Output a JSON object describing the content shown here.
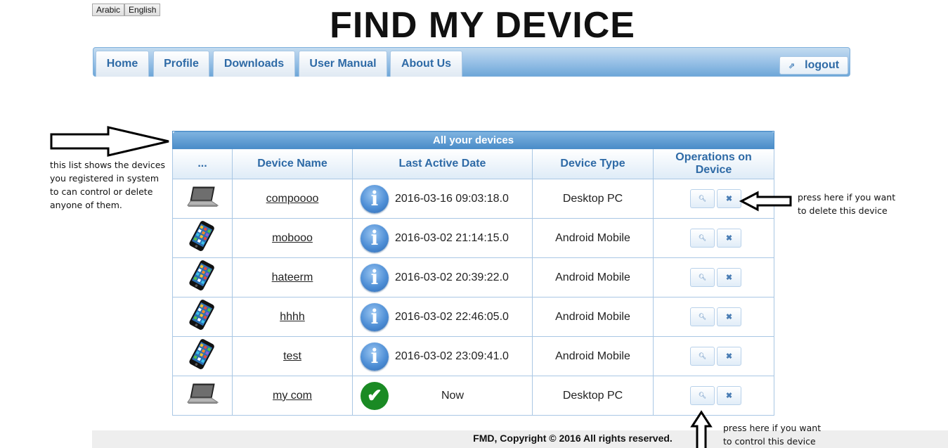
{
  "languages": [
    "Arabic",
    "English"
  ],
  "page_title": "FIND MY DEVICE",
  "nav": {
    "tabs": [
      "Home",
      "Profile",
      "Downloads",
      "User Manual",
      "About Us"
    ],
    "logout_label": "logout"
  },
  "annotations": {
    "list_note": [
      "this list shows the devices",
      "you registered in system",
      "to can control or delete",
      "anyone of them."
    ],
    "delete_note": [
      "press here if you want",
      "to delete this device"
    ],
    "control_note": [
      "press here if you want",
      "to control this device"
    ]
  },
  "table": {
    "caption": "All your devices",
    "headers": [
      "...",
      "Device Name",
      "Last Active Date",
      "Device Type",
      "Operations on Device"
    ],
    "rows": [
      {
        "icon": "laptop-icon",
        "name": "compoooo",
        "status_icon": "info-icon",
        "last_active": "2016-03-16 09:03:18.0",
        "type": "Desktop PC"
      },
      {
        "icon": "phone-icon",
        "name": "mobooo",
        "status_icon": "info-icon",
        "last_active": "2016-03-02 21:14:15.0",
        "type": "Android Mobile"
      },
      {
        "icon": "phone-icon",
        "name": "hateerm",
        "status_icon": "info-icon",
        "last_active": "2016-03-02 20:39:22.0",
        "type": "Android Mobile"
      },
      {
        "icon": "phone-icon",
        "name": "hhhh",
        "status_icon": "info-icon",
        "last_active": "2016-03-02 22:46:05.0",
        "type": "Android Mobile"
      },
      {
        "icon": "phone-icon",
        "name": "test",
        "status_icon": "info-icon",
        "last_active": "2016-03-02 23:09:41.0",
        "type": "Android Mobile"
      },
      {
        "icon": "laptop-icon",
        "name": "my com",
        "status_icon": "check-icon",
        "last_active": "Now",
        "type": "Desktop PC"
      }
    ],
    "operations": {
      "control_icon": "search-icon",
      "delete_icon": "close-icon"
    }
  },
  "footer": "FMD, Copyright © 2016 All rights reserved.",
  "colors": {
    "accent": "#4a8cc8",
    "nav_text": "#2e6aa6",
    "online": "#1a8a24"
  }
}
